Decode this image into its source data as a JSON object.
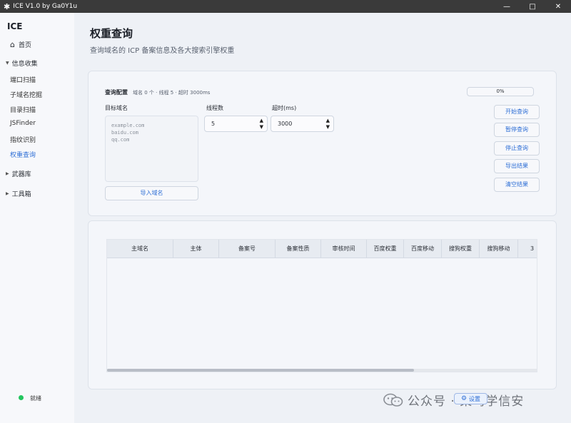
{
  "window": {
    "title": "ICE V1.0 by Ga0Y1u",
    "minimize": "—",
    "maximize": "□",
    "close": "✕"
  },
  "sidebar": {
    "brand": "ICE",
    "home": {
      "label": "首页",
      "icon": "home-icon"
    },
    "groups": [
      {
        "label": "信息收集",
        "expanded": true,
        "items": [
          "端口扫描",
          "子域名挖掘",
          "目录扫描",
          "JSFinder",
          "指纹识别",
          "权重查询"
        ]
      },
      {
        "label": "武器库",
        "expanded": false
      },
      {
        "label": "工具箱",
        "expanded": false
      }
    ],
    "active_item": "权重查询"
  },
  "page": {
    "title": "权重查询",
    "subtitle": "查询域名的 ICP 备案信息及各大搜索引擎权重"
  },
  "config": {
    "title": "查询配置",
    "summary": "域名 0 个 · 线程 5 · 超时 3000ms",
    "progress": {
      "value": 0,
      "text": "0%"
    },
    "domain_label": "目标域名",
    "domain_placeholder": "example.com\nbaidu.com\nqq.com",
    "import_button": "导入域名",
    "threads_label": "线程数",
    "threads_value": "5",
    "timeout_label": "超时(ms)",
    "timeout_value": "3000",
    "spin_up": "▲",
    "spin_down": "▼",
    "buttons": {
      "start": "开始查询",
      "pause": "暂停查询",
      "stop": "停止查询",
      "export": "导出结果",
      "clear": "清空结果"
    }
  },
  "table": {
    "columns": [
      "主域名",
      "主体",
      "备案号",
      "备案性质",
      "审核时间",
      "百度权重",
      "百度移动",
      "搜狗权重",
      "搜狗移动",
      "3"
    ],
    "rows": []
  },
  "status": {
    "text": "就绪",
    "color": "#22c55e"
  },
  "settings_button": {
    "label": "设置",
    "icon": "settings-icon"
  },
  "watermark": {
    "text": "公众号 · 菜鸟学信安",
    "icon": "wechat-icon"
  },
  "colors": {
    "accent": "#2f6fd6",
    "titlebar": "#3a3a3a",
    "ok": "#22c55e"
  }
}
